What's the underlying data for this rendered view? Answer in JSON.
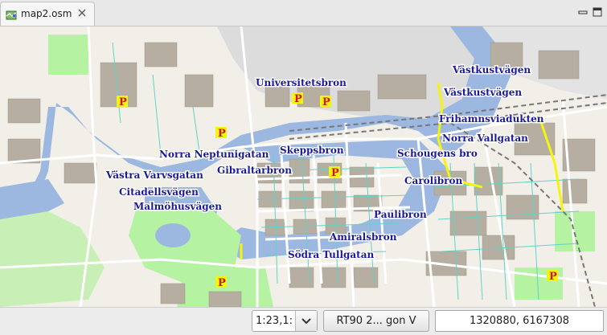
{
  "tab": {
    "title": "map2.osm",
    "icon": "map-file-icon",
    "close_icon": "close-icon"
  },
  "window_controls": {
    "minimize_icon": "minimize-icon",
    "maximize_icon": "maximize-icon"
  },
  "map": {
    "street_labels": [
      "Universitetsbron",
      "Västkustvägen",
      "Västkustvägen",
      "Frihamnsviadukten",
      "Norra Vallgatan",
      "Norra Neptunigatan",
      "Skeppsbron",
      "Schougens bro",
      "Västra Varvsgatan",
      "Gibraltarbron",
      "Citadellsvägen",
      "Carolibron",
      "Malmöhusvägen",
      "Paulibron",
      "Amiralsbron",
      "Södra Tullgatan"
    ],
    "parking_label": "P",
    "colors": {
      "water": "#9cb8e0",
      "park": "#b5f2a2",
      "building": "#b6aea0",
      "land": "#f2efe9",
      "road": "#ffffff",
      "street_casing": "#5fd3c5",
      "label": "#1b1b9a",
      "parking": "#d01515",
      "highlight_road": "#f4f411"
    }
  },
  "status": {
    "scale": "1:23,1:",
    "scale_dropdown_icon": "chevron-down-icon",
    "crs_button": "RT90 2... gon V",
    "coordinates": "1320880, 6167308"
  }
}
